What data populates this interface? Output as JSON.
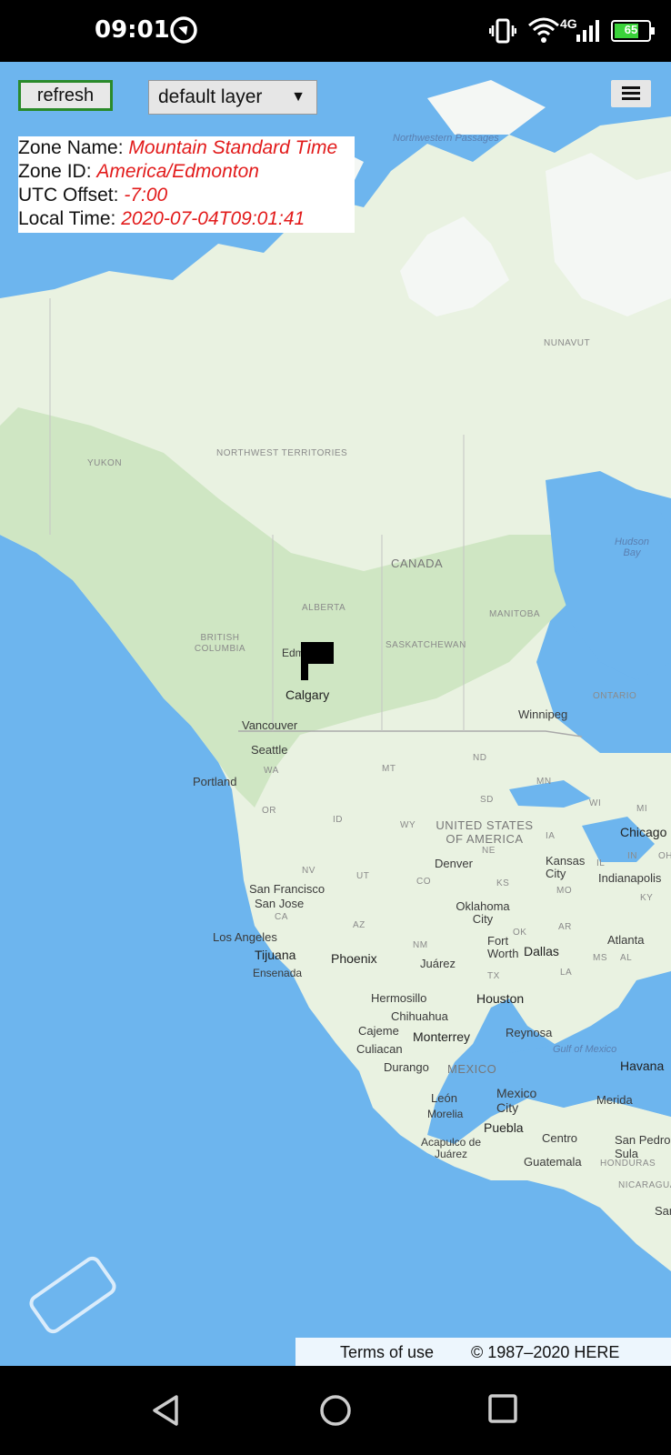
{
  "status_bar": {
    "time": "09:01",
    "network": "4G",
    "battery": "65",
    "icons": [
      "focus-mode-icon",
      "vibrate-icon",
      "wifi-icon",
      "signal-icon",
      "battery-icon"
    ]
  },
  "toolbar": {
    "refresh_label": "refresh",
    "layer_select_value": "default layer",
    "menu_icon": "hamburger-menu-icon"
  },
  "info": {
    "zone_name_label": "Zone Name: ",
    "zone_name_value": "Mountain Standard Time",
    "zone_id_label": "Zone ID: ",
    "zone_id_value": "America/Edmonton",
    "utc_offset_label": "UTC Offset: ",
    "utc_offset_value": "-7:00",
    "local_time_label": "Local Time: ",
    "local_time_value": "2020-07-04T09:01:41"
  },
  "map": {
    "regions": [
      "Northwestern Passages",
      "NUNAVUT",
      "YUKON",
      "NORTHWEST TERRITORIES",
      "CANADA",
      "ALBERTA",
      "MANITOBA",
      "BRITISH COLUMBIA",
      "SASKATCHEWAN",
      "ONTARIO",
      "UNITED STATES OF AMERICA",
      "MEXICO",
      "HONDURAS",
      "NICARAGUA"
    ],
    "water": [
      "Hudson Bay",
      "Gulf of Mexico"
    ],
    "states": [
      "ND",
      "MN",
      "WA",
      "MT",
      "SD",
      "WI",
      "MI",
      "OR",
      "ID",
      "WY",
      "IA",
      "NE",
      "IL",
      "IN",
      "OH",
      "NV",
      "UT",
      "CO",
      "KS",
      "MO",
      "KY",
      "CA",
      "OK",
      "AR",
      "AZ",
      "NM",
      "TX",
      "LA",
      "MS",
      "AL"
    ],
    "cities": [
      "Edmonton",
      "Calgary",
      "Vancouver",
      "Seattle",
      "Portland",
      "Winnipeg",
      "Chicago",
      "Kansas City",
      "Indianapolis",
      "Denver",
      "San Francisco",
      "San Jose",
      "Oklahoma City",
      "Los Angeles",
      "Tijuana",
      "Ensenada",
      "Phoenix",
      "Fort Worth",
      "Dallas",
      "Atlanta",
      "Juárez",
      "Hermosillo",
      "Chihuahua",
      "Houston",
      "Cajeme",
      "Monterrey",
      "Reynosa",
      "Culiacan",
      "Durango",
      "Havana",
      "Mexico City",
      "Merida",
      "León",
      "Morelia",
      "Puebla",
      "Acapulco de Juárez",
      "Centro",
      "San Pedro Sula",
      "Guatemala",
      "San"
    ]
  },
  "footer": {
    "terms_label": "Terms of use",
    "copyright": "© 1987–2020 HERE"
  },
  "navbar": {
    "icons": [
      "back-icon",
      "home-icon",
      "recents-icon"
    ]
  }
}
